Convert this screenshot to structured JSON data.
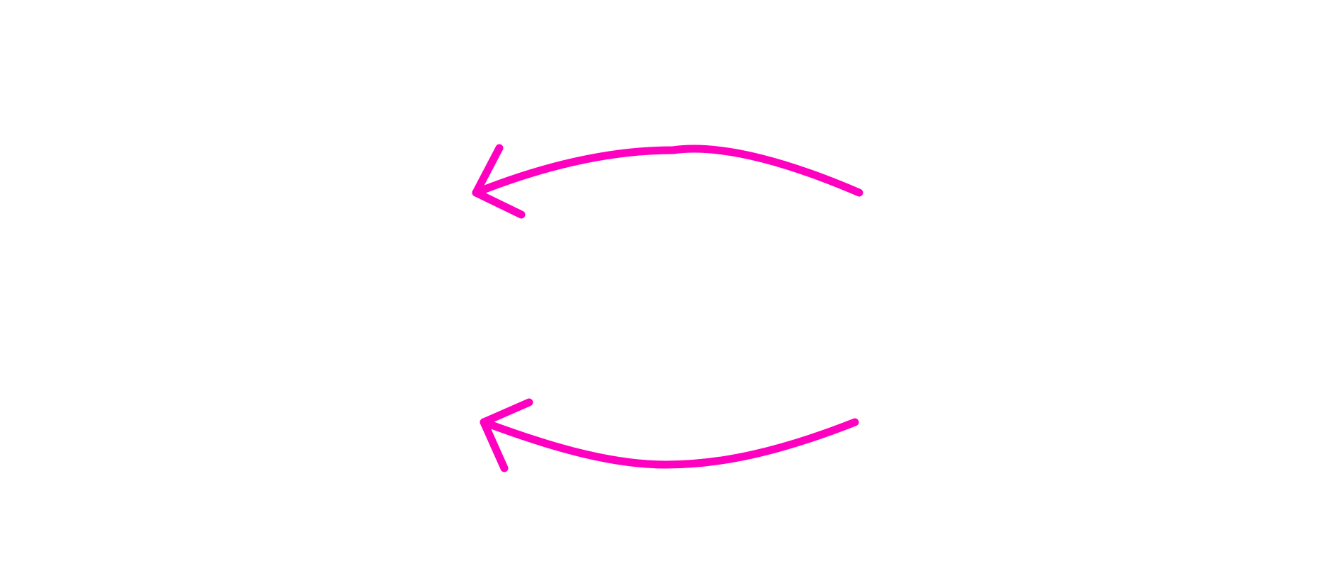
{
  "canvas": {
    "background": "#ffffff"
  },
  "arrows": [
    {
      "id": "top",
      "direction": "left",
      "color": "#ff00c0",
      "icon": "curved-arrow-left-icon"
    },
    {
      "id": "bottom",
      "direction": "left",
      "color": "#ff00c0",
      "icon": "curved-arrow-left-icon"
    }
  ]
}
